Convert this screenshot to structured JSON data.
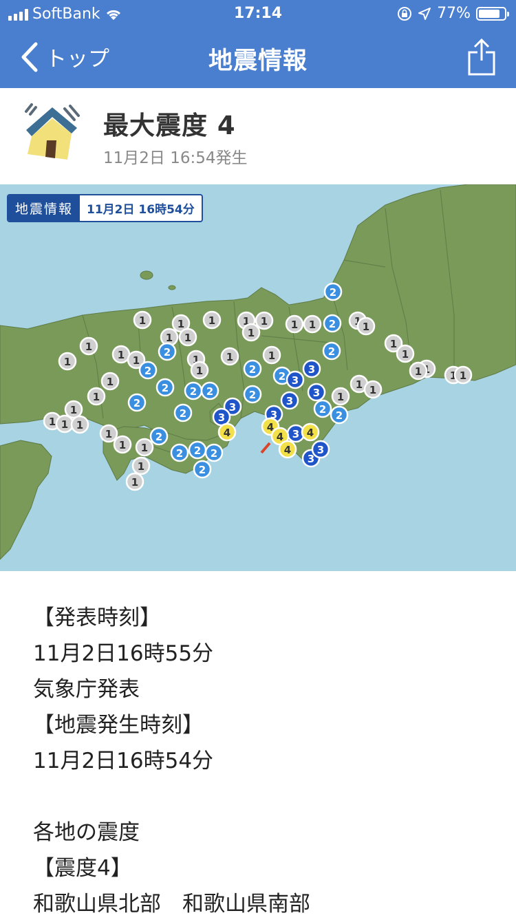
{
  "status_bar": {
    "carrier": "SoftBank",
    "time": "17:14",
    "battery": "77%",
    "battery_level": 0.77
  },
  "nav": {
    "back_label": "トップ",
    "title": "地震情報"
  },
  "header": {
    "title": "最大震度 4",
    "subtitle": "11月2日 16:54発生"
  },
  "map": {
    "badge_label": "地震情報",
    "badge_date": "11月2日 16時54分",
    "colors": {
      "sea": "#a8d3e2",
      "land": "#7a9a5a",
      "intensity_1": "#cfcfcf",
      "intensity_2": "#3b8fe0",
      "intensity_3": "#1f55c8",
      "intensity_4": "#f2e04a"
    },
    "markers": [
      "1",
      "1",
      "1",
      "1",
      "1",
      "1",
      "1",
      "1",
      "1",
      "1",
      "1",
      "1",
      "1",
      "1",
      "1",
      "1",
      "1",
      "1",
      "1",
      "1",
      "1",
      "1",
      "1",
      "1",
      "1",
      "1",
      "1",
      "1",
      "1",
      "1",
      "1",
      "1",
      "1",
      "1",
      "1",
      "1",
      "1",
      "1",
      "1",
      "1",
      "2",
      "2",
      "2",
      "2",
      "2",
      "2",
      "2",
      "2",
      "2",
      "2",
      "2",
      "2",
      "2",
      "2",
      "2",
      "2",
      "2",
      "2",
      "2",
      "2",
      "3",
      "3",
      "3",
      "3",
      "3",
      "3",
      "3",
      "3",
      "3",
      "3",
      "4",
      "4",
      "4",
      "4",
      "4"
    ]
  },
  "content": {
    "lines": [
      "【発表時刻】",
      "11月2日16時55分",
      "気象庁発表",
      "【地震発生時刻】",
      "11月2日16時54分",
      "",
      "各地の震度",
      "【震度4】",
      "和歌山県北部　和歌山県南部"
    ]
  }
}
